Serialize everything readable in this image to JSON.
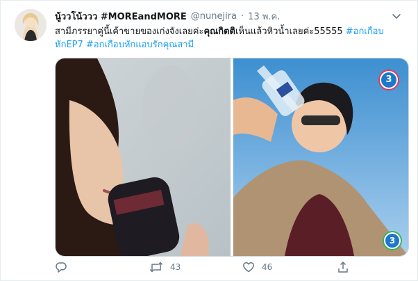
{
  "tweet": {
    "display_name": "นู้ววโน้ววว #MOREandMORE",
    "handle": "@nunejira",
    "separator": "·",
    "date": "13 พ.ค.",
    "text_part1": "สามีภรรยาคู่นี้เค้าขายของเก่งจังเลยค่ะ",
    "text_bold": "คุณกิตติ",
    "text_part2": "เห็นแล้วหิวน้ำเลยค่ะ55555 ",
    "hashtag1": "#อกเกือบหักEP7",
    "hashtag2": "#อกเกือบหักแอบรักคุณสามี"
  },
  "media": {
    "left_image": "woman-drinking-from-can",
    "right_image": "man-drinking-from-bottle",
    "channel_logo": "3"
  },
  "actions": {
    "reply_count": "",
    "retweet_count": "43",
    "like_count": "46",
    "share_count": ""
  },
  "colors": {
    "accent": "#1da1f2",
    "muted": "#657786",
    "logo_blue": "#1E78C8"
  }
}
